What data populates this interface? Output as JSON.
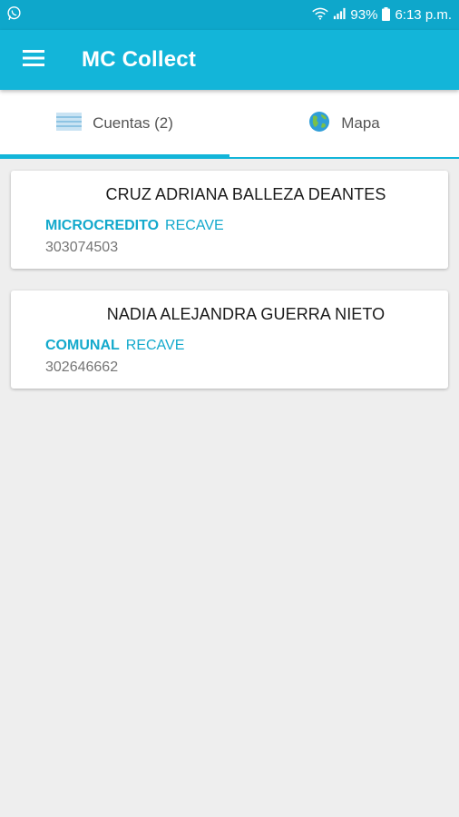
{
  "status_bar": {
    "battery": "93%",
    "time": "6:13 p.m."
  },
  "app_bar": {
    "title": "MC Collect"
  },
  "tabs": [
    {
      "label": "Cuentas (2)",
      "icon": "list-icon",
      "active": true
    },
    {
      "label": "Mapa",
      "icon": "globe-icon",
      "active": false
    }
  ],
  "accounts": [
    {
      "name": "CRUZ ADRIANA BALLEZA DEANTES",
      "type": "MICROCREDITO",
      "subtype": "RECAVE",
      "id": "303074503"
    },
    {
      "name": "NADIA ALEJANDRA GUERRA NIETO",
      "type": "COMUNAL",
      "subtype": "RECAVE",
      "id": "302646662"
    }
  ],
  "colors": {
    "status_bar": "#0ea7cb",
    "app_bar": "#13b5d9",
    "accent": "#13a9cc",
    "background": "#eeeeee"
  }
}
